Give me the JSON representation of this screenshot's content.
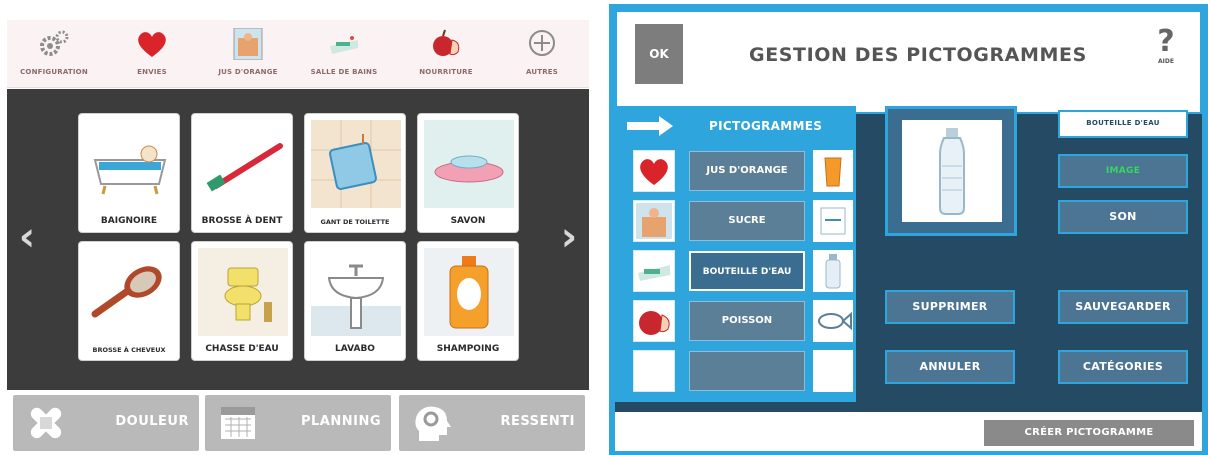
{
  "left": {
    "topbar": {
      "items": [
        {
          "label": "CONFIGURATION",
          "icon": "gears-icon"
        },
        {
          "label": "ENVIES",
          "icon": "heart-icon"
        },
        {
          "label": "JUS D'ORANGE",
          "icon": "picture-icon"
        },
        {
          "label": "SALLE DE BAINS",
          "icon": "bathroom-icon"
        },
        {
          "label": "NOURRITURE",
          "icon": "apple-icon"
        },
        {
          "label": "AUTRES",
          "icon": "plus-circle-icon"
        }
      ]
    },
    "grid": {
      "prev_arrow": "‹",
      "next_arrow": "›",
      "cards": [
        {
          "label": "BAIGNOIRE",
          "icon": "bathtub-icon"
        },
        {
          "label": "BROSSE À DENT",
          "icon": "toothbrush-icon"
        },
        {
          "label": "GANT DE TOILETTE",
          "icon": "washcloth-icon"
        },
        {
          "label": "SAVON",
          "icon": "soap-icon"
        },
        {
          "label": "BROSSE À CHEVEUX",
          "icon": "hairbrush-icon"
        },
        {
          "label": "CHASSE D'EAU",
          "icon": "toilet-icon"
        },
        {
          "label": "LAVABO",
          "icon": "sink-icon"
        },
        {
          "label": "SHAMPOING",
          "icon": "shampoo-icon"
        }
      ]
    },
    "bottombar": {
      "buttons": [
        {
          "label": "DOULEUR",
          "icon": "bandage-icon"
        },
        {
          "label": "PLANNING",
          "icon": "calendar-icon"
        },
        {
          "label": "RESSENTI",
          "icon": "head-gears-icon"
        }
      ]
    }
  },
  "right": {
    "ok_label": "OK",
    "title": "GESTION DES PICTOGRAMMES",
    "help_symbol": "?",
    "help_label": "AIDE",
    "picto_panel": {
      "header": "PICTOGRAMMES",
      "rows": [
        {
          "label": "JUS D'ORANGE",
          "thumb": "heart-icon",
          "side": "juice-glass-icon"
        },
        {
          "label": "SUCRE",
          "thumb": "picture-icon",
          "side": "sugar-icon"
        },
        {
          "label": "BOUTEILLE D'EAU",
          "thumb": "bathroom-icon",
          "side": "water-bottle-icon",
          "active": true
        },
        {
          "label": "POISSON",
          "thumb": "apple-icon",
          "side": "fish-icon"
        }
      ]
    },
    "preview": {
      "icon": "water-bottle-icon"
    },
    "buttons": {
      "name_field": "BOUTEILLE D'EAU",
      "image": "IMAGE",
      "sound": "SON",
      "delete": "SUPPRIMER",
      "save": "SAUVEGARDER",
      "cancel": "ANNULER",
      "categories": "CATÉGORIES"
    },
    "create_label": "CRÉER PICTOGRAMME",
    "colors": {
      "accent": "#2ea5dc",
      "panel": "#254a63",
      "button": "#4c7594"
    }
  }
}
